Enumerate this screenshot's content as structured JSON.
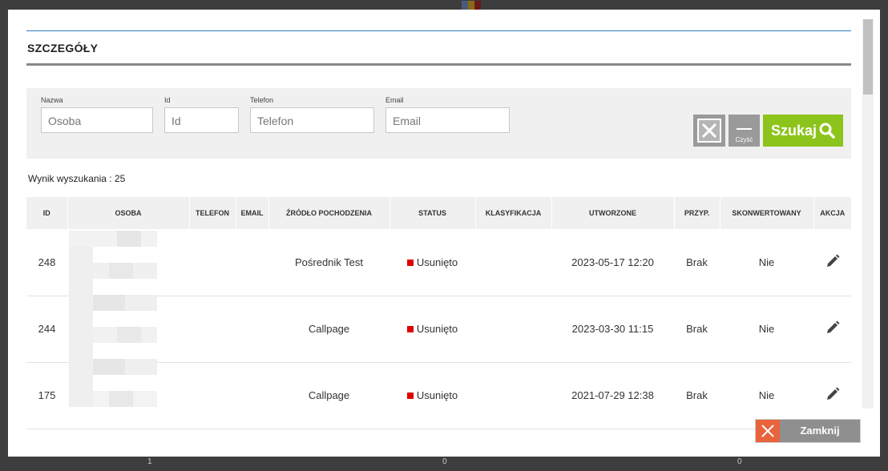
{
  "modal": {
    "title": "SZCZEGÓŁY",
    "close_label": "Zamknij"
  },
  "filters": {
    "fields": [
      {
        "label": "Nazwa",
        "placeholder": "Osoba"
      },
      {
        "label": "Id",
        "placeholder": "Id"
      },
      {
        "label": "Telefon",
        "placeholder": "Telefon"
      },
      {
        "label": "Email",
        "placeholder": "Email"
      }
    ],
    "clear_label": "Czyść",
    "search_label": "Szukaj"
  },
  "results": {
    "summary": "Wynik wyszukania : 25"
  },
  "table": {
    "headers": [
      "ID",
      "OSOBA",
      "TELEFON",
      "EMAIL",
      "ŹRÓDŁO POCHODZENIA",
      "STATUS",
      "KLASYFIKACJA",
      "UTWORZONE",
      "PRZYP.",
      "SKONWERTOWANY",
      "AKCJA"
    ],
    "rows": [
      {
        "id": "248",
        "source": "Pośrednik Test",
        "status": "Usunięto",
        "created": "2023-05-17 12:20",
        "assigned": "Brak",
        "converted": "Nie"
      },
      {
        "id": "244",
        "source": "Callpage",
        "status": "Usunięto",
        "created": "2023-03-30 11:15",
        "assigned": "Brak",
        "converted": "Nie"
      },
      {
        "id": "175",
        "source": "Callpage",
        "status": "Usunięto",
        "created": "2021-07-29 12:38",
        "assigned": "Brak",
        "converted": "Nie"
      }
    ]
  },
  "background": {
    "bottom_values": [
      "1",
      "0",
      "0"
    ]
  },
  "colors": {
    "accent_line": "#2a7bbf",
    "search_button": "#8cc41c",
    "close_icon": "#e9633d",
    "status_deleted": "#e00000"
  },
  "icons": [
    "excel-export-icon",
    "clear-icon",
    "search-icon",
    "edit-pencil-icon",
    "close-icon"
  ]
}
